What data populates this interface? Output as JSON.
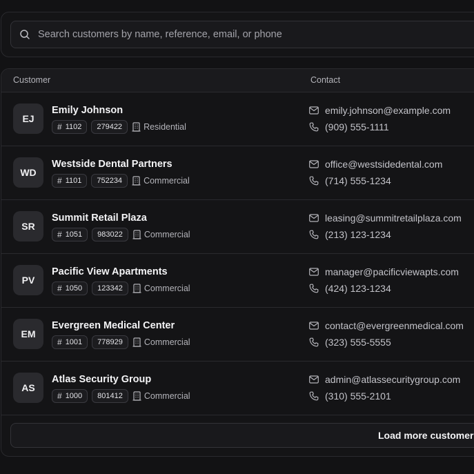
{
  "search": {
    "placeholder": "Search customers by name, reference, email, or phone",
    "value": ""
  },
  "table": {
    "columns": [
      "Customer",
      "Contact"
    ],
    "rows": [
      {
        "initials": "EJ",
        "name": "Emily Johnson",
        "number": "1102",
        "reference": "279422",
        "type": "Residential",
        "email": "emily.johnson@example.com",
        "phone": "(909) 555-1111"
      },
      {
        "initials": "WD",
        "name": "Westside Dental Partners",
        "number": "1101",
        "reference": "752234",
        "type": "Commercial",
        "email": "office@westsidedental.com",
        "phone": "(714) 555-1234"
      },
      {
        "initials": "SR",
        "name": "Summit Retail Plaza",
        "number": "1051",
        "reference": "983022",
        "type": "Commercial",
        "email": "leasing@summitretailplaza.com",
        "phone": "(213) 123-1234"
      },
      {
        "initials": "PV",
        "name": "Pacific View Apartments",
        "number": "1050",
        "reference": "123342",
        "type": "Commercial",
        "email": "manager@pacificviewapts.com",
        "phone": "(424) 123-1234"
      },
      {
        "initials": "EM",
        "name": "Evergreen Medical Center",
        "number": "1001",
        "reference": "778929",
        "type": "Commercial",
        "email": "contact@evergreenmedical.com",
        "phone": "(323) 555-5555"
      },
      {
        "initials": "AS",
        "name": "Atlas Security Group",
        "number": "1000",
        "reference": "801412",
        "type": "Commercial",
        "email": "admin@atlassecuritygroup.com",
        "phone": "(310) 555-2101"
      }
    ]
  },
  "load_more_label": "Load more customers",
  "icons": {
    "search": "search-icon",
    "number": "hash-icon",
    "type": "building-icon",
    "email": "mail-icon",
    "phone": "phone-icon"
  },
  "colors": {
    "background": "#121214",
    "panel": "#141416",
    "border": "#2a2a2e",
    "avatar": "#2a2a2e",
    "text_primary": "#f4f4f6",
    "text_secondary": "#b4b4ba"
  }
}
